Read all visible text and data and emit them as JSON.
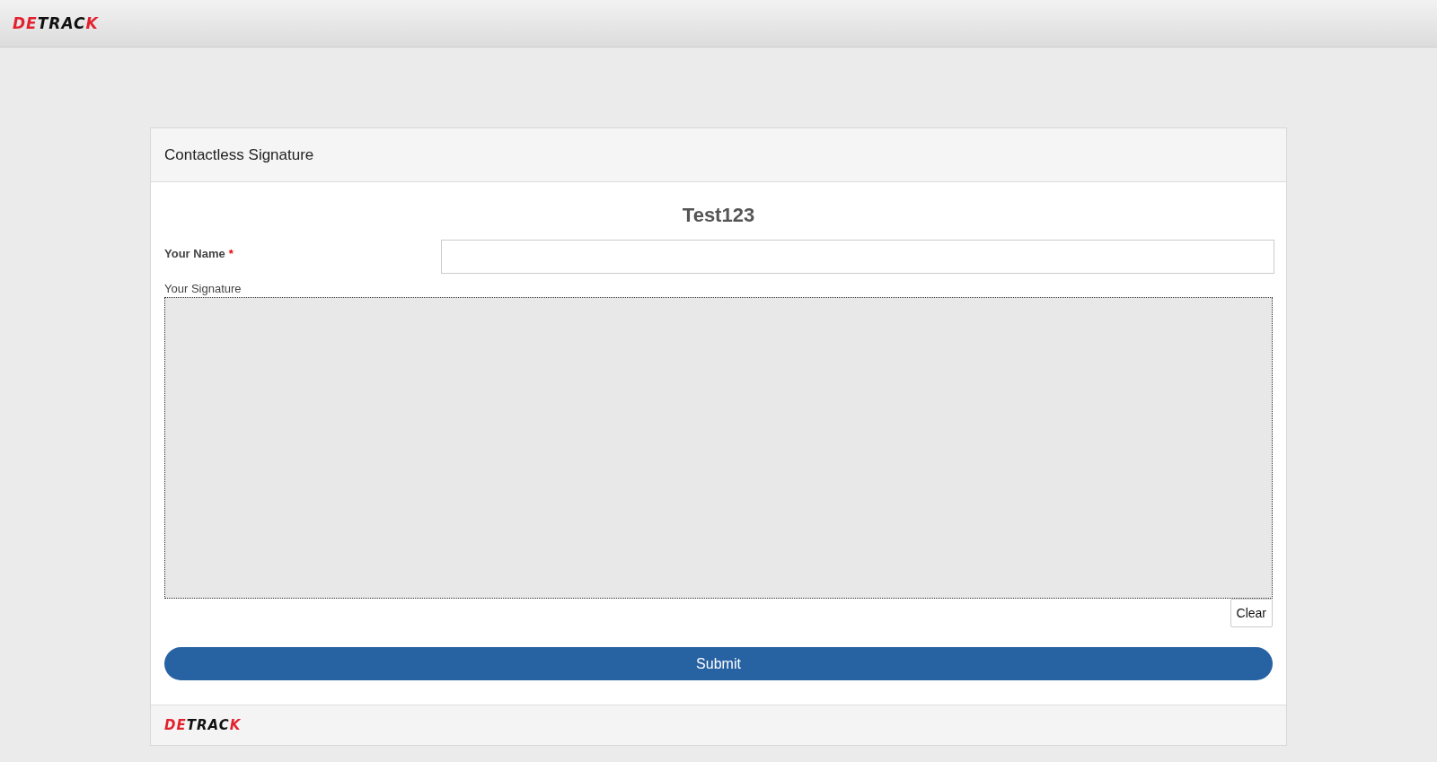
{
  "header": {
    "logo": "DETRACK"
  },
  "card": {
    "title": "Contactless Signature",
    "heading": "Test123",
    "name_field": {
      "label": "Your Name",
      "required_mark": "*"
    },
    "signature": {
      "label": "Your Signature",
      "clear_button": "Clear"
    },
    "submit_button": "Submit",
    "footer": {
      "logo": "DETRACK"
    }
  }
}
